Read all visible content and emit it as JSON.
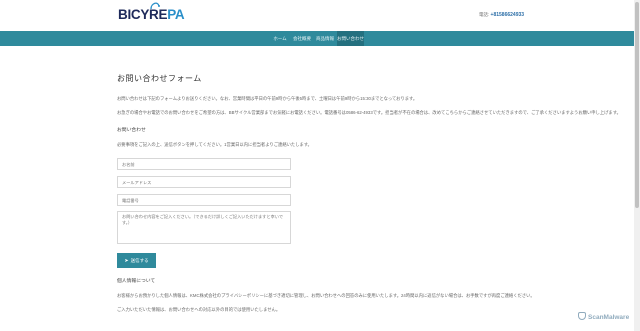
{
  "header": {
    "logo_main": "BICYRE",
    "logo_accent": "PA",
    "phone_label": "電話:",
    "phone_number": "+81586624933"
  },
  "nav": {
    "items": [
      {
        "label": "ホーム"
      },
      {
        "label": "会社概要"
      },
      {
        "label": "商品情報"
      },
      {
        "label": "お問い合わせ"
      }
    ]
  },
  "main": {
    "title": "お問い合わせフォーム",
    "paragraph1": "お問い合わせは下記のフォームよりお送りください。なお、営業時間は平日の午前9時から午後5時まで、土曜日は午前9時から15:30までとなっております。",
    "paragraph2": "お急ぎの場合やお電話でのお問い合わせをご希望の方は、BBサイクル営業部までお気軽にお電話ください。電話番号は0586-62-4933です。担当者が不在の場合は、改めてこちらからご連絡させていただきますので、ご了承くださいますようお願い申し上げます。",
    "section_heading": "お問い合わせ",
    "section_text": "必要事項をご記入の上、送信ボタンを押してください。1営業日以内に担当者よりご連絡いたします。",
    "form": {
      "name_placeholder": "お名前",
      "email_placeholder": "メールアドレス",
      "phone_placeholder": "電話番号",
      "message_placeholder": "お問い合わせ内容をご記入ください。（できるだけ詳しくご記入いただけますと幸いです。）",
      "submit_label": "送信する"
    },
    "footer_heading": "個人情報について",
    "footer_text1": "お客様からお預かりした個人情報は、KMC株式会社のプライバシーポリシーに基づき適切に管理し、お問い合わせへの回答のみに使用いたします。24時間以内に返信がない場合は、お手数ですが再度ご連絡ください。",
    "footer_text2": "ご入力いただいた情報は、お問い合わせへの対応以外の目的では使用いたしません。"
  },
  "badge": {
    "label": "ScanMalware"
  }
}
